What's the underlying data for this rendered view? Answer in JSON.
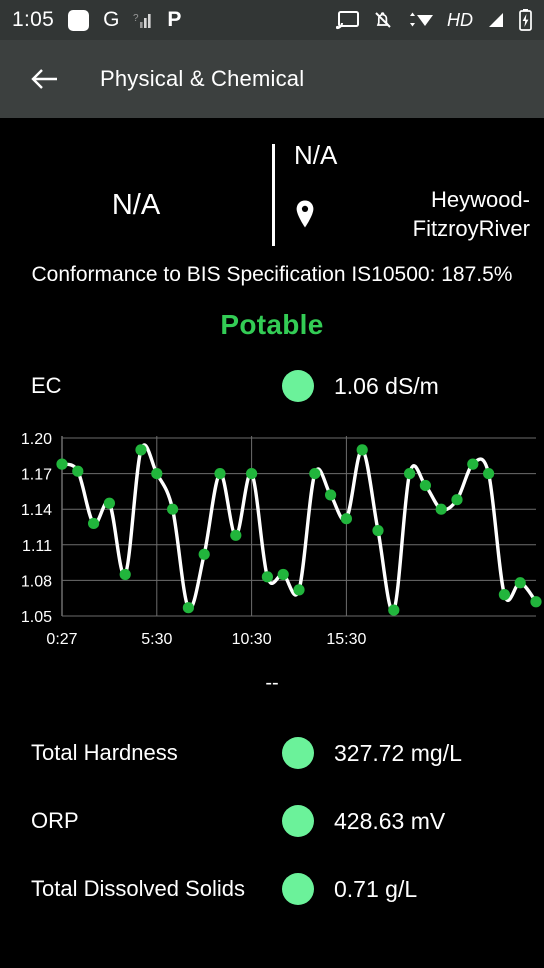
{
  "status_bar": {
    "clock": "1:05",
    "left_icons": [
      "rounded-square-icon",
      "g-icon",
      "signal-unknown-icon",
      "p-icon"
    ],
    "g_label": "G",
    "p_label": "P",
    "hd_label": "HD",
    "right_icons": [
      "cast-icon",
      "notifications-off-icon",
      "wifi-icon",
      "hd-icon",
      "cell-signal-icon",
      "battery-charging-icon"
    ]
  },
  "app_bar": {
    "back_label": "back-arrow",
    "title": "Physical & Chemical"
  },
  "summary": {
    "primary_value": "N/A",
    "secondary_value": "N/A",
    "location_name": "Heywood-FitzroyRiver",
    "conformance": "Conformance to BIS Specification IS10500: 187.5%",
    "status": "Potable",
    "status_color": "#33cc55"
  },
  "colors": {
    "dot_green": "#6bf29a",
    "line_white": "#ffffff",
    "point_green": "#21b53c",
    "grid": "#6d6d6d",
    "appbar_bg": "#3c403f",
    "statusbar_bg": "#323635",
    "page_bg": "#000000"
  },
  "ec_metric": {
    "label": "EC",
    "value": "1.06 dS/m",
    "dot_color": "#6bf29a"
  },
  "chart_placeholder": "--",
  "metrics": [
    {
      "label": "Total Hardness",
      "value": "327.72 mg/L",
      "dot_color": "#6bf29a"
    },
    {
      "label": "ORP",
      "value": "428.63 mV",
      "dot_color": "#6bf29a"
    },
    {
      "label": "Total Dissolved Solids",
      "value": "0.71 g/L",
      "dot_color": "#6bf29a"
    }
  ],
  "chart_data": {
    "type": "line",
    "title": "",
    "xlabel": "",
    "ylabel": "",
    "ylim": [
      1.05,
      1.2
    ],
    "yticks": [
      "1.05",
      "1.08",
      "1.11",
      "1.14",
      "1.17",
      "1.20"
    ],
    "ytick_values": [
      1.05,
      1.08,
      1.11,
      1.14,
      1.17,
      1.2
    ],
    "xticks": [
      "0:27",
      "5:30",
      "10:30",
      "15:30"
    ],
    "xtick_positions": [
      0,
      6,
      12,
      18
    ],
    "grid": true,
    "legend": "none",
    "series": [
      {
        "name": "EC",
        "unit": "dS/m",
        "markers": true,
        "values": [
          1.178,
          1.172,
          1.128,
          1.145,
          1.085,
          1.19,
          1.17,
          1.14,
          1.057,
          1.102,
          1.17,
          1.118,
          1.17,
          1.083,
          1.085,
          1.072,
          1.17,
          1.152,
          1.132,
          1.19,
          1.122,
          1.055,
          1.17,
          1.16,
          1.14,
          1.148,
          1.178,
          1.17,
          1.068,
          1.078,
          1.062
        ]
      }
    ]
  }
}
